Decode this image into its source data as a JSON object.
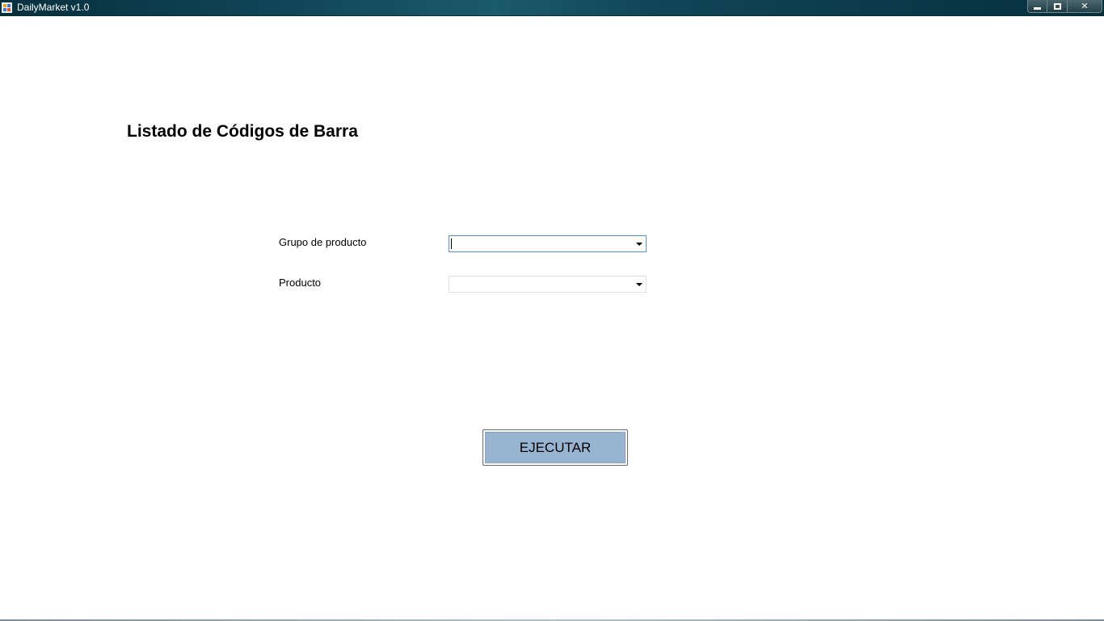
{
  "window": {
    "title": "DailyMarket v1.0",
    "icon": "app-icon",
    "controls": {
      "minimize_icon": "minimize-icon",
      "maximize_icon": "maximize-icon",
      "close_label": "✕"
    }
  },
  "form": {
    "title": "Listado de Códigos de Barra",
    "fields": [
      {
        "label": "Grupo de producto",
        "value": "",
        "focused": true
      },
      {
        "label": "Producto",
        "value": "",
        "focused": false
      }
    ],
    "execute_label": "EJECUTAR"
  },
  "colors": {
    "titlebar": "#0f4557",
    "button_face": "#99b4d1",
    "focus_border": "#5e90c2"
  }
}
